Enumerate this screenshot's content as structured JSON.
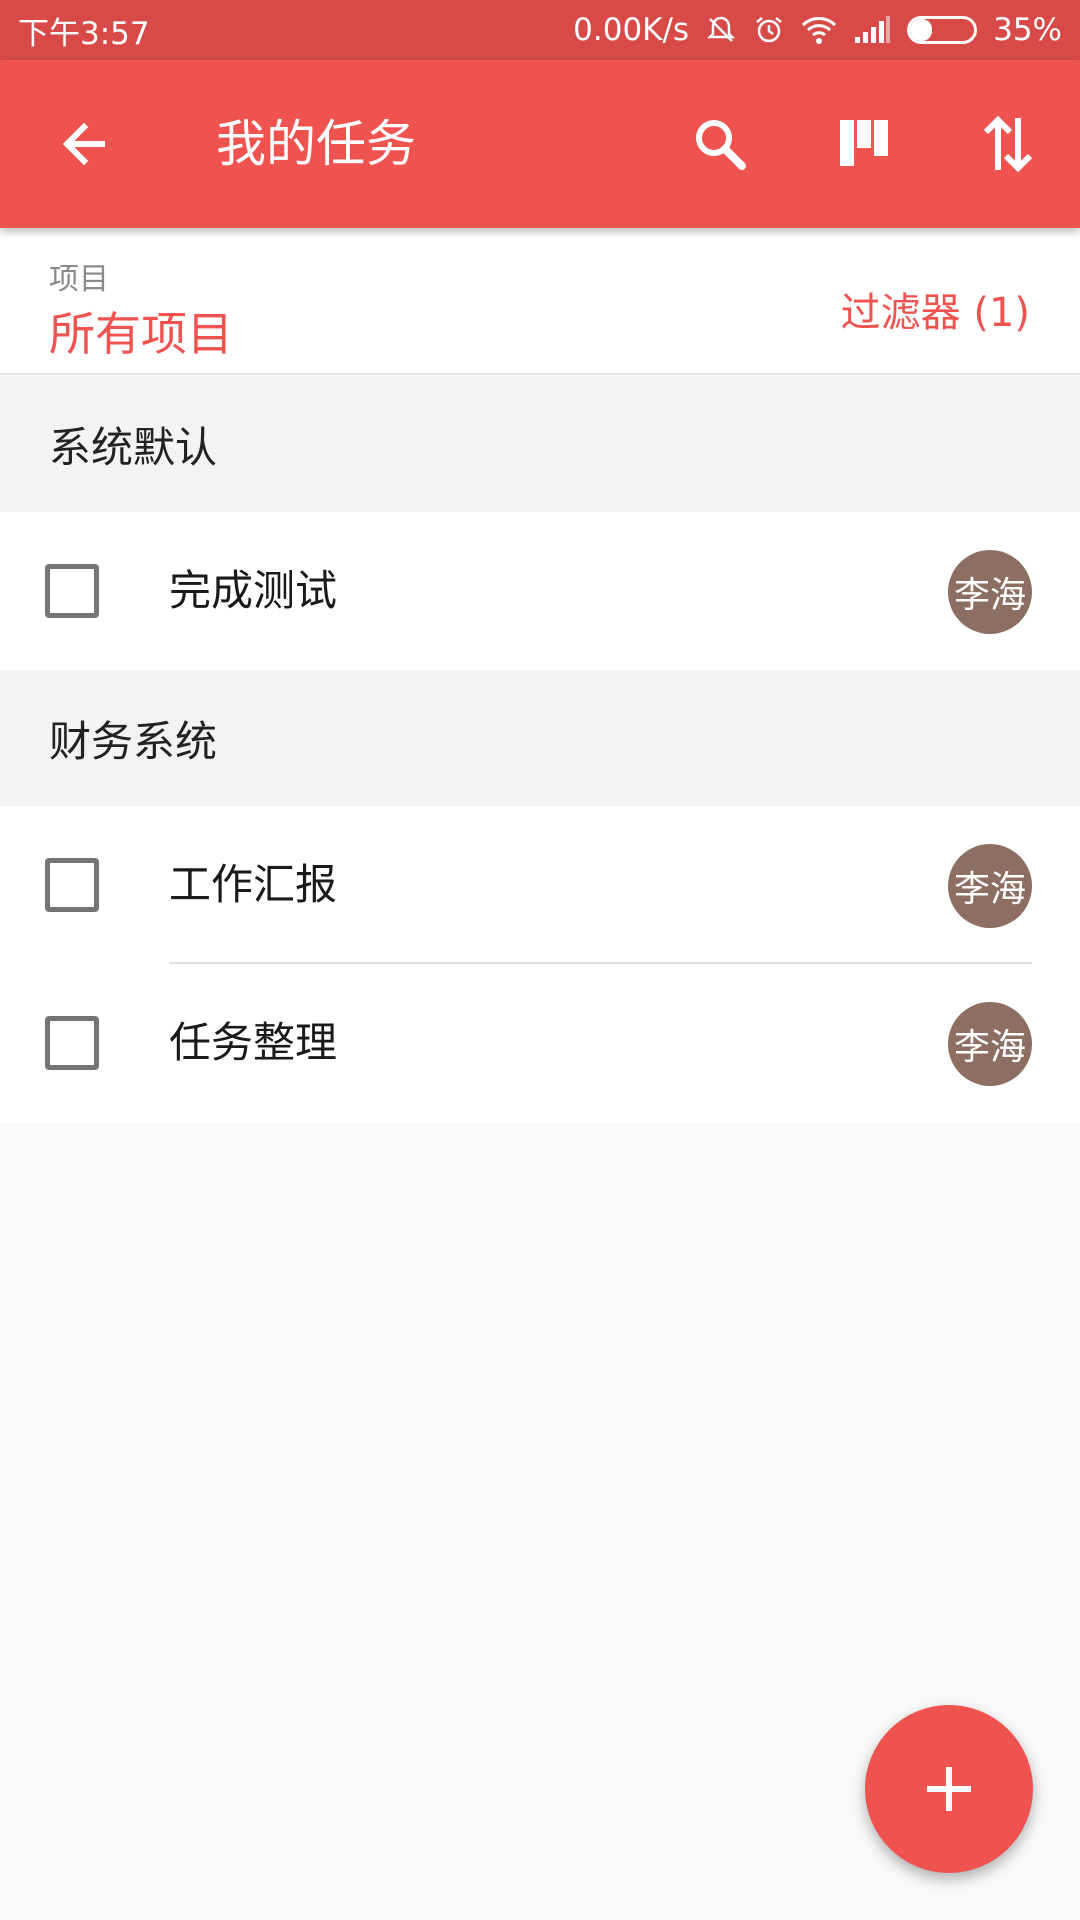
{
  "status_bar": {
    "time": "下午3:57",
    "net_speed": "0.00K/s",
    "battery_percent": "35%",
    "battery_level": 0.35
  },
  "app_bar": {
    "title": "我的任务",
    "icons": [
      "back-arrow-icon",
      "search-icon",
      "board-view-icon",
      "sort-icon"
    ]
  },
  "filter": {
    "label": "项目",
    "value": "所有项目",
    "filter_button": "过滤器 (1)"
  },
  "groups": [
    {
      "name": "系统默认",
      "tasks": [
        {
          "title": "完成测试",
          "assignee": "李海"
        }
      ]
    },
    {
      "name": "财务系统",
      "tasks": [
        {
          "title": "工作汇报",
          "assignee": "李海"
        },
        {
          "title": "任务整理",
          "assignee": "李海"
        }
      ]
    }
  ],
  "colors": {
    "primary": "#ef5350",
    "status_bar": "#d74a47",
    "avatar": "#8d6e63"
  }
}
